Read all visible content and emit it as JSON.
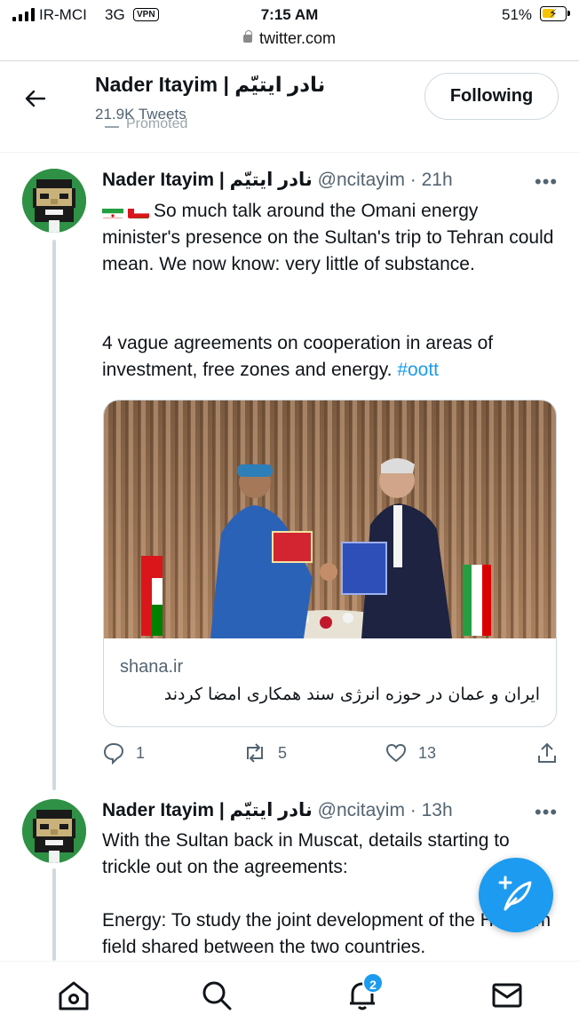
{
  "status_bar": {
    "carrier": "IR-MCI",
    "network": "3G",
    "vpn": "VPN",
    "time": "7:15 AM",
    "battery": "51%"
  },
  "browser": {
    "url": "twitter.com"
  },
  "header": {
    "title": "Nader Itayim | نادر ایتیّم",
    "tweets_count": "21.9K Tweets",
    "follow_label": "Following",
    "peek": "Promoted"
  },
  "tweets": [
    {
      "name": "Nader Itayim | نادر ایتیّم",
      "meta": "@ncitayim · 21h",
      "text_1": "So much talk around the Omani energy minister's presence on the Sultan's trip to Tehran could mean. We now know: very little of substance.",
      "text_2": "4 vague agreements on cooperation in areas of investment, free zones and energy.",
      "hashtag": "#oott",
      "card": {
        "domain": "shana.ir",
        "title": "ایران و عمان در حوزه انرژی سند همکاری امضا کردند"
      },
      "replies": "1",
      "retweets": "5",
      "likes": "13"
    },
    {
      "name": "Nader Itayim | نادر ایتیّم",
      "meta": "@ncitayim · 13h",
      "text_1": "With the Sultan back in Muscat, details starting to trickle out on the agreements:",
      "text_2": "Energy: To study the joint development of the Hengam field shared between the two countries."
    }
  ],
  "notifications_badge": "2",
  "colors": {
    "accent": "#1d9bf0",
    "avatar_bg": "#2e9146",
    "muted_text": "#536471"
  }
}
